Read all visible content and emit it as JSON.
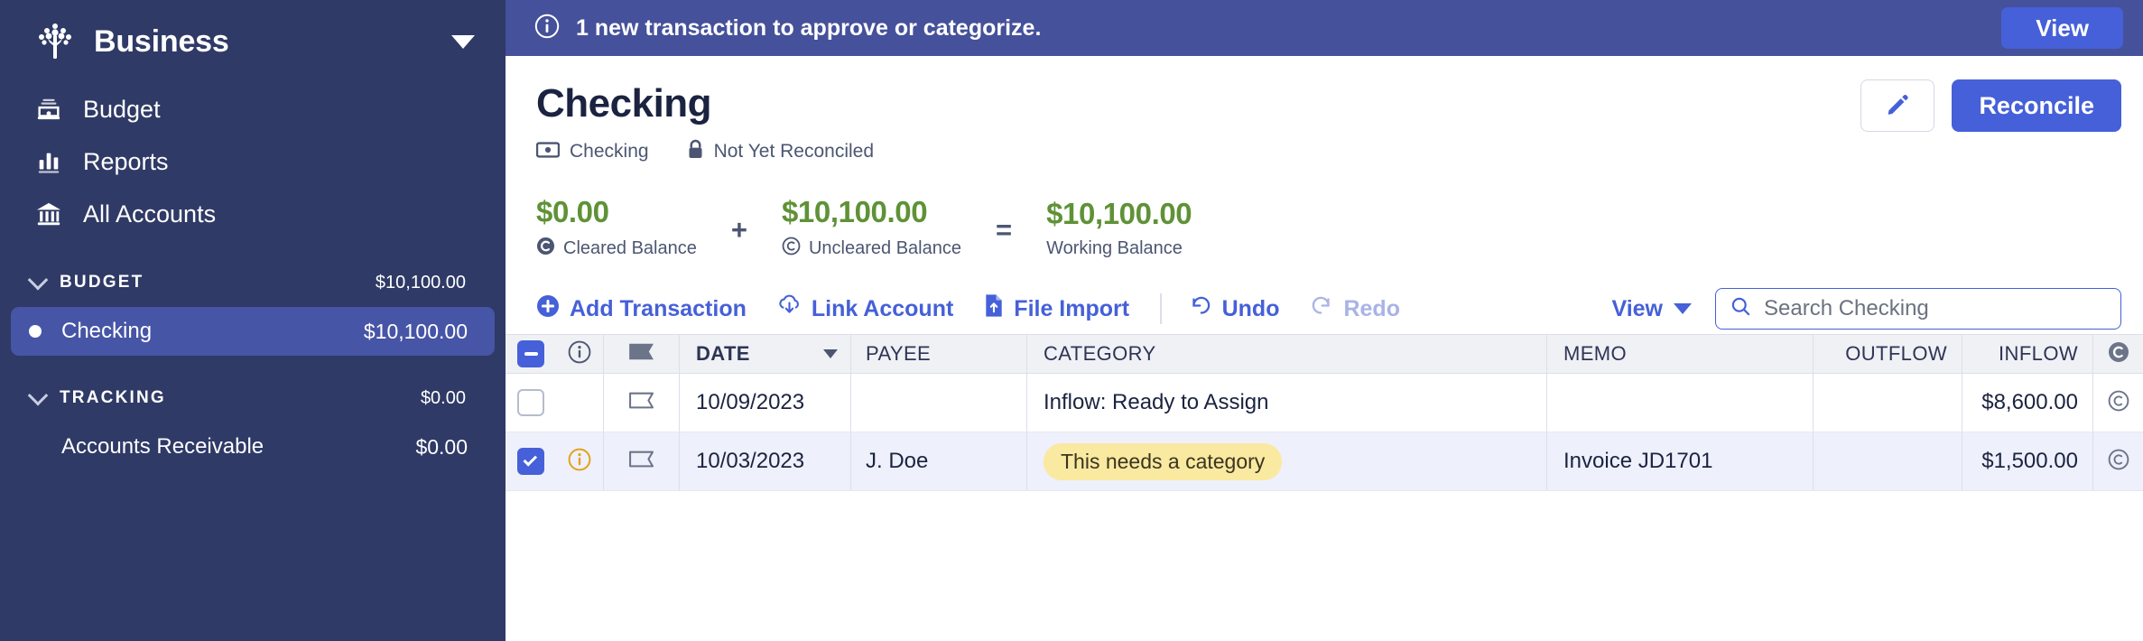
{
  "sidebar": {
    "budget_name": "Business",
    "logo_icon": "tree-logo-icon",
    "switcher_icon": "chevron-down-icon",
    "nav": [
      {
        "label": "Budget",
        "icon": "budget-icon"
      },
      {
        "label": "Reports",
        "icon": "bar-chart-icon"
      },
      {
        "label": "All Accounts",
        "icon": "bank-icon"
      }
    ],
    "groups": [
      {
        "title": "BUDGET",
        "amount": "$10,100.00",
        "accounts": [
          {
            "name": "Checking",
            "amount": "$10,100.00",
            "selected": true,
            "has_dot": true
          }
        ]
      },
      {
        "title": "TRACKING",
        "amount": "$0.00",
        "accounts": [
          {
            "name": "Accounts Receivable",
            "amount": "$0.00",
            "selected": false,
            "has_dot": false
          }
        ]
      }
    ]
  },
  "banner": {
    "icon": "info-circle-icon",
    "message": "1 new transaction to approve or categorize.",
    "action_label": "View",
    "bg_color": "#45519a",
    "button_color": "#4560d8"
  },
  "account_header": {
    "title": "Checking",
    "type_icon": "banknote-icon",
    "type_label": "Checking",
    "lock_icon": "lock-icon",
    "reconcile_status": "Not Yet Reconciled",
    "edit_icon": "pencil-icon",
    "reconcile_label": "Reconcile"
  },
  "balances": {
    "color": "#5f9237",
    "items": [
      {
        "amount": "$0.00",
        "label": "Cleared Balance",
        "icon": "cleared-filled-icon"
      },
      {
        "amount": "$10,100.00",
        "label": "Uncleared Balance",
        "icon": "cleared-outline-icon"
      },
      {
        "amount": "$10,100.00",
        "label": "Working Balance",
        "icon": "none"
      }
    ],
    "operators": [
      "+",
      "="
    ]
  },
  "toolbar": {
    "add_transaction": "Add Transaction",
    "add_transaction_icon": "plus-circle-icon",
    "link_account": "Link Account",
    "link_account_icon": "cloud-download-icon",
    "file_import": "File Import",
    "file_import_icon": "file-upload-icon",
    "undo": "Undo",
    "undo_icon": "undo-arrow-icon",
    "redo": "Redo",
    "redo_icon": "redo-arrow-icon",
    "redo_disabled": true,
    "view": "View",
    "view_icon": "chevron-down-icon",
    "search_icon": "search-icon",
    "search_placeholder": "Search Checking",
    "search_value": ""
  },
  "table": {
    "headers": {
      "select": "",
      "info": "",
      "flag": "",
      "date": "DATE",
      "payee": "PAYEE",
      "category": "CATEGORY",
      "memo": "MEMO",
      "outflow": "OUTFLOW",
      "inflow": "INFLOW",
      "cleared": "C"
    },
    "header_select_state": "indeterminate",
    "sort_column": "DATE",
    "sort_icon": "sort-caret-down-icon",
    "rows": [
      {
        "selected": false,
        "has_alert": false,
        "alert_icon": "",
        "flag_icon": "flag-outline-icon",
        "date": "10/09/2023",
        "payee": "",
        "category": "Inflow: Ready to Assign",
        "category_is_chip": false,
        "memo": "",
        "outflow": "",
        "inflow": "$8,600.00",
        "cleared_icon": "cleared-outline-icon"
      },
      {
        "selected": true,
        "has_alert": true,
        "alert_icon": "warning-info-icon",
        "flag_icon": "flag-outline-icon",
        "date": "10/03/2023",
        "payee": "J. Doe",
        "category": "This needs a category",
        "category_is_chip": true,
        "memo": "Invoice JD1701",
        "outflow": "",
        "inflow": "$1,500.00",
        "cleared_icon": "cleared-outline-icon"
      }
    ]
  }
}
